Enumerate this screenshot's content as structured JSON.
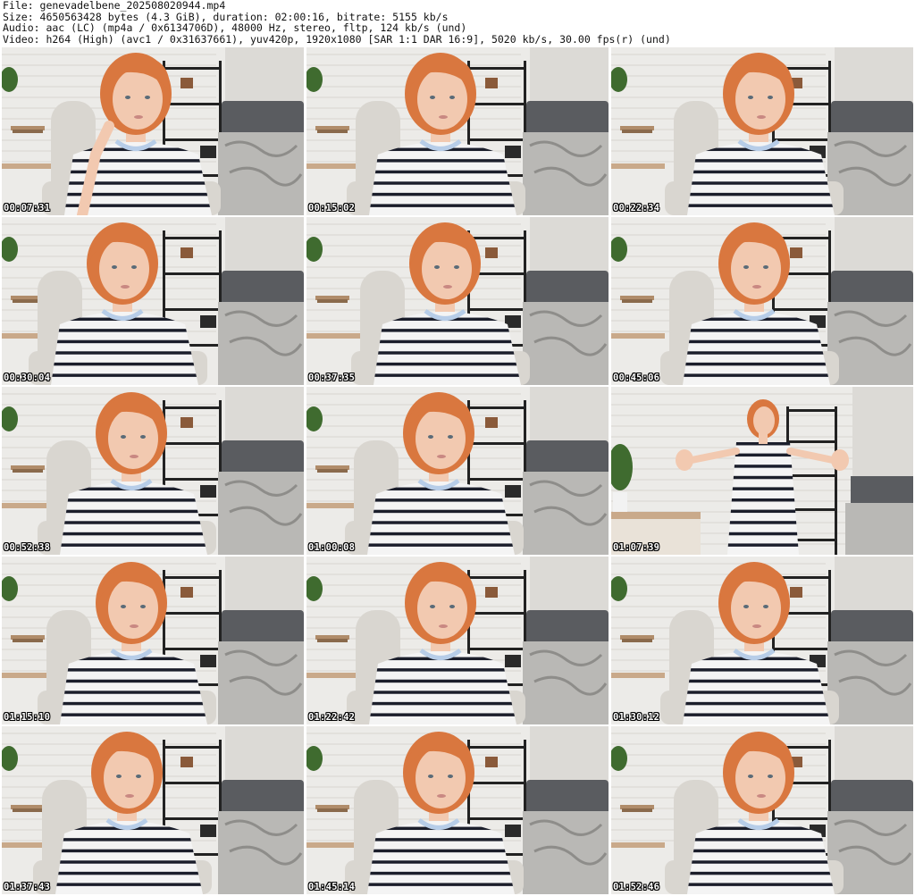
{
  "header": {
    "file_line": "File: genevadelbene_202508020944.mp4",
    "size_line": "Size: 4650563428 bytes (4.3 GiB), duration: 02:00:16, bitrate: 5155 kb/s",
    "audio_line": "Audio: aac (LC) (mp4a / 0x6134706D), 48000 Hz, stereo, fltp, 124 kb/s (und)",
    "video_line": "Video: h264 (High) (avc1 / 0x31637661), yuv420p, 1920x1080 [SAR 1:1 DAR 16:9], 5020 kb/s, 30.00 fps(r) (und)"
  },
  "colors": {
    "wall": "#ecebe8",
    "brick_line": "#d8d6d1",
    "hair": "#d9773f",
    "skin": "#f2c9b0",
    "stripe_dark": "#1b1e2b",
    "stripe_light": "#f4f4f4",
    "chair": "#d9d6d0",
    "bed": "#5a5c60",
    "blanket": "#b9b8b5",
    "shelf": "#222222",
    "plant": "#3f6b2f",
    "desk": "#c9a98a"
  },
  "frames": [
    {
      "timestamp": "00:07:31",
      "pose": "hand-to-ear",
      "offset": 0
    },
    {
      "timestamp": "00:15:02",
      "pose": "seated",
      "offset": 0
    },
    {
      "timestamp": "00:22:34",
      "pose": "seated",
      "offset": 15
    },
    {
      "timestamp": "00:30:04",
      "pose": "seated",
      "offset": -15
    },
    {
      "timestamp": "00:37:35",
      "pose": "seated",
      "offset": 5
    },
    {
      "timestamp": "00:45:06",
      "pose": "seated",
      "offset": 10
    },
    {
      "timestamp": "00:52:38",
      "pose": "seated",
      "offset": -5
    },
    {
      "timestamp": "01:00:08",
      "pose": "seated",
      "offset": -2
    },
    {
      "timestamp": "01:07:39",
      "pose": "standing",
      "offset": 0
    },
    {
      "timestamp": "01:15:10",
      "pose": "seated",
      "offset": -5
    },
    {
      "timestamp": "01:22:42",
      "pose": "seated",
      "offset": 0
    },
    {
      "timestamp": "01:30:12",
      "pose": "seated",
      "offset": 10
    },
    {
      "timestamp": "01:37:43",
      "pose": "seated",
      "offset": -10
    },
    {
      "timestamp": "01:45:14",
      "pose": "seated",
      "offset": -2
    },
    {
      "timestamp": "01:52:46",
      "pose": "seated",
      "offset": 15
    }
  ]
}
